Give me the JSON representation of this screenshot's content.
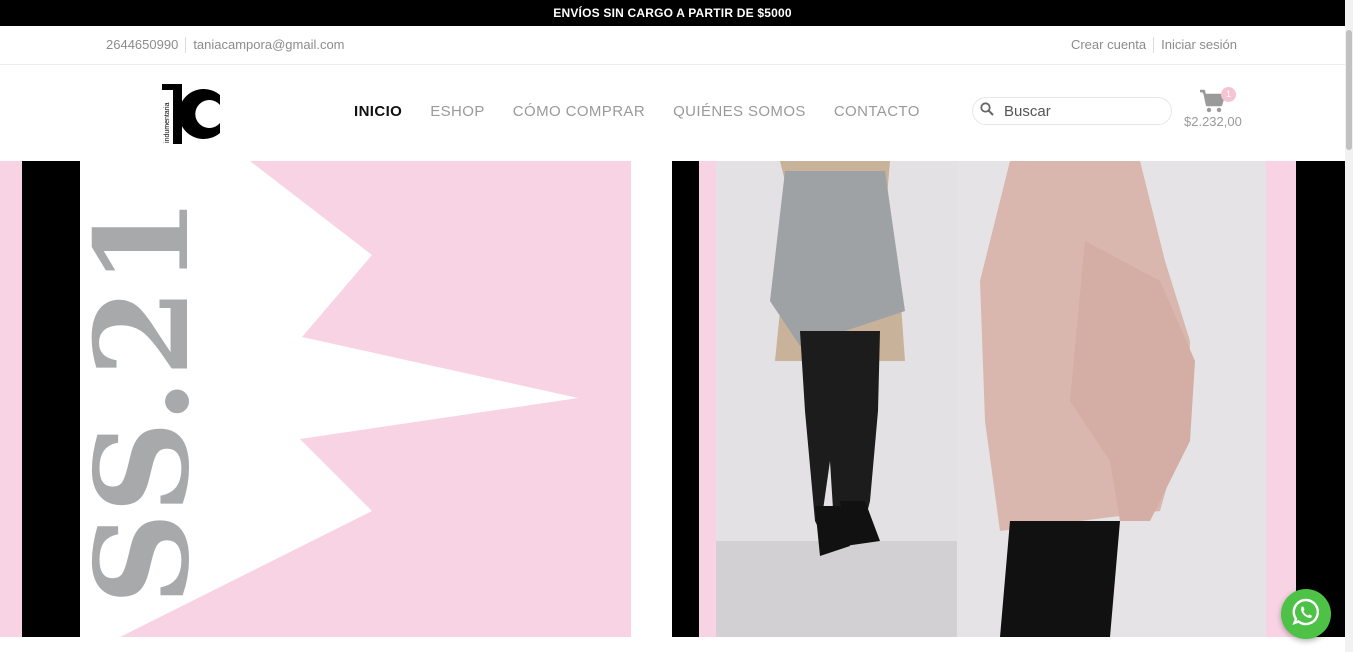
{
  "promo": {
    "text": "ENVÍOS SIN CARGO A PARTIR DE $5000"
  },
  "topbar": {
    "phone": "2644650990",
    "email": "taniacampora@gmail.com",
    "create_account": "Crear cuenta",
    "login": "Iniciar sesión"
  },
  "logo": {
    "letters": "TC",
    "tagline": "indumentaria"
  },
  "nav": {
    "items": [
      {
        "label": "INICIO",
        "active": true
      },
      {
        "label": "ESHOP"
      },
      {
        "label": "CÓMO COMPRAR"
      },
      {
        "label": "QUIÉNES SOMOS"
      },
      {
        "label": "CONTACTO"
      }
    ]
  },
  "search": {
    "placeholder": "Buscar",
    "icon": "search-icon"
  },
  "cart": {
    "count": "1",
    "total": "$2.232,00",
    "icon": "cart-icon"
  },
  "hero": {
    "season_text": "SS.21"
  },
  "whatsapp": {
    "icon": "whatsapp-icon"
  },
  "colors": {
    "accent_pink": "#f7d3e4",
    "whatsapp_green": "#4dc247",
    "black": "#000000"
  }
}
